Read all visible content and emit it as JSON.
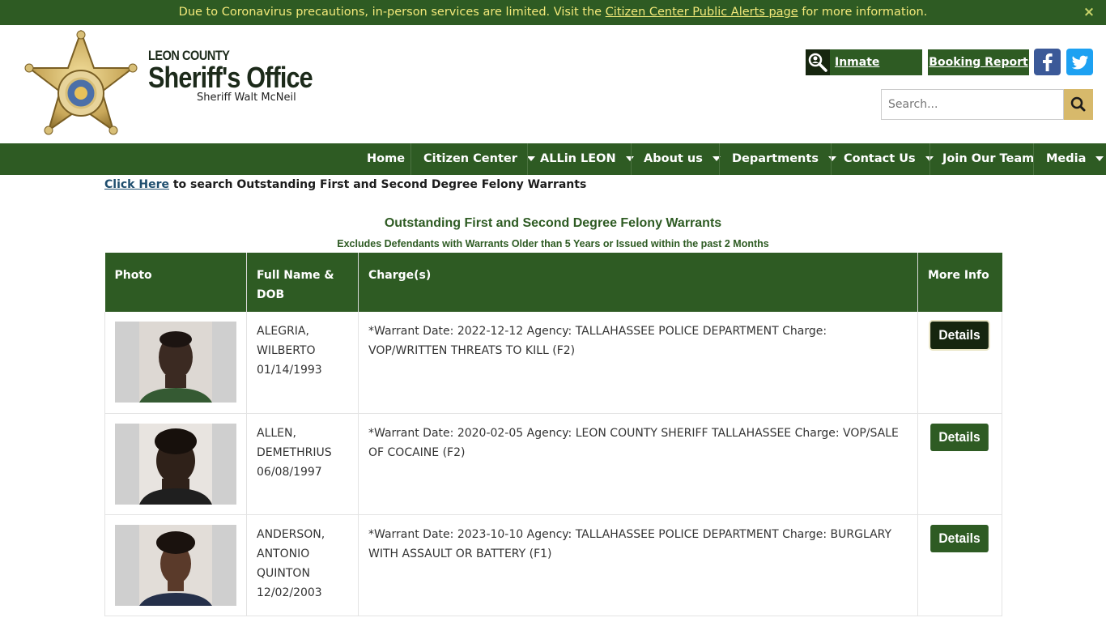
{
  "alert": {
    "text_before": "Due to Coronavirus precautions, in-person services are limited. Visit the ",
    "link_text": "Citizen Center Public Alerts page",
    "text_after": " for more information.",
    "close_icon": "×"
  },
  "header": {
    "brand_county": "LEON COUNTY",
    "brand_office": "Sheriff's Office",
    "brand_sheriff": "Sheriff Walt McNeil",
    "logo_icon": "sheriff-star-icon",
    "inmate_search_label": "Inmate Search",
    "booking_report_label": "Booking Report",
    "facebook_icon": "facebook-icon",
    "twitter_icon": "twitter-icon",
    "search_placeholder": "Search...",
    "search_icon": "search-icon"
  },
  "nav": {
    "items": [
      {
        "label": "Home",
        "dropdown": false
      },
      {
        "label": "Citizen Center",
        "dropdown": true
      },
      {
        "label": "ALLin LEON",
        "dropdown": true
      },
      {
        "label": "About us",
        "dropdown": true
      },
      {
        "label": "Departments",
        "dropdown": true
      },
      {
        "label": "Contact Us",
        "dropdown": true
      },
      {
        "label": "Join Our Team",
        "dropdown": false
      },
      {
        "label": "Media",
        "dropdown": true
      }
    ]
  },
  "content": {
    "click_here": "Click Here",
    "click_rest": " to search Outstanding First and Second Degree Felony Warrants",
    "title": "Outstanding First and Second Degree Felony Warrants",
    "subtitle": "Excludes Defendants with Warrants Older than 5 Years or Issued within the past 2 Months"
  },
  "table": {
    "headers": [
      "Photo",
      "Full Name & DOB",
      "Charge(s)",
      "More Info"
    ],
    "rows": [
      {
        "name_line1": "ALEGRIA,",
        "name_line2": "WILBERTO",
        "name_line3": "",
        "dob": "01/14/1993",
        "charge": "*Warrant Date: 2022-12-12 Agency: TALLAHASSEE POLICE DEPARTMENT Charge: VOP/WRITTEN THREATS TO KILL (F2)",
        "button": "Details"
      },
      {
        "name_line1": "ALLEN,",
        "name_line2": "DEMETHRIUS",
        "name_line3": "",
        "dob": "06/08/1997",
        "charge": "*Warrant Date: 2020-02-05 Agency: LEON COUNTY SHERIFF TALLAHASSEE Charge: VOP/SALE OF COCAINE (F2)",
        "button": "Details"
      },
      {
        "name_line1": "ANDERSON,",
        "name_line2": "ANTONIO",
        "name_line3": "QUINTON",
        "dob": "12/02/2003",
        "charge": "*Warrant Date: 2023-10-10 Agency: TALLAHASSEE POLICE DEPARTMENT Charge: BURGLARY WITH ASSAULT OR BATTERY (F1)",
        "button": "Details"
      }
    ]
  },
  "colors": {
    "primary_green": "#2e5b23",
    "dark_green": "#16260f",
    "alert_text": "#f3e97a",
    "search_button": "#d7b96b"
  }
}
